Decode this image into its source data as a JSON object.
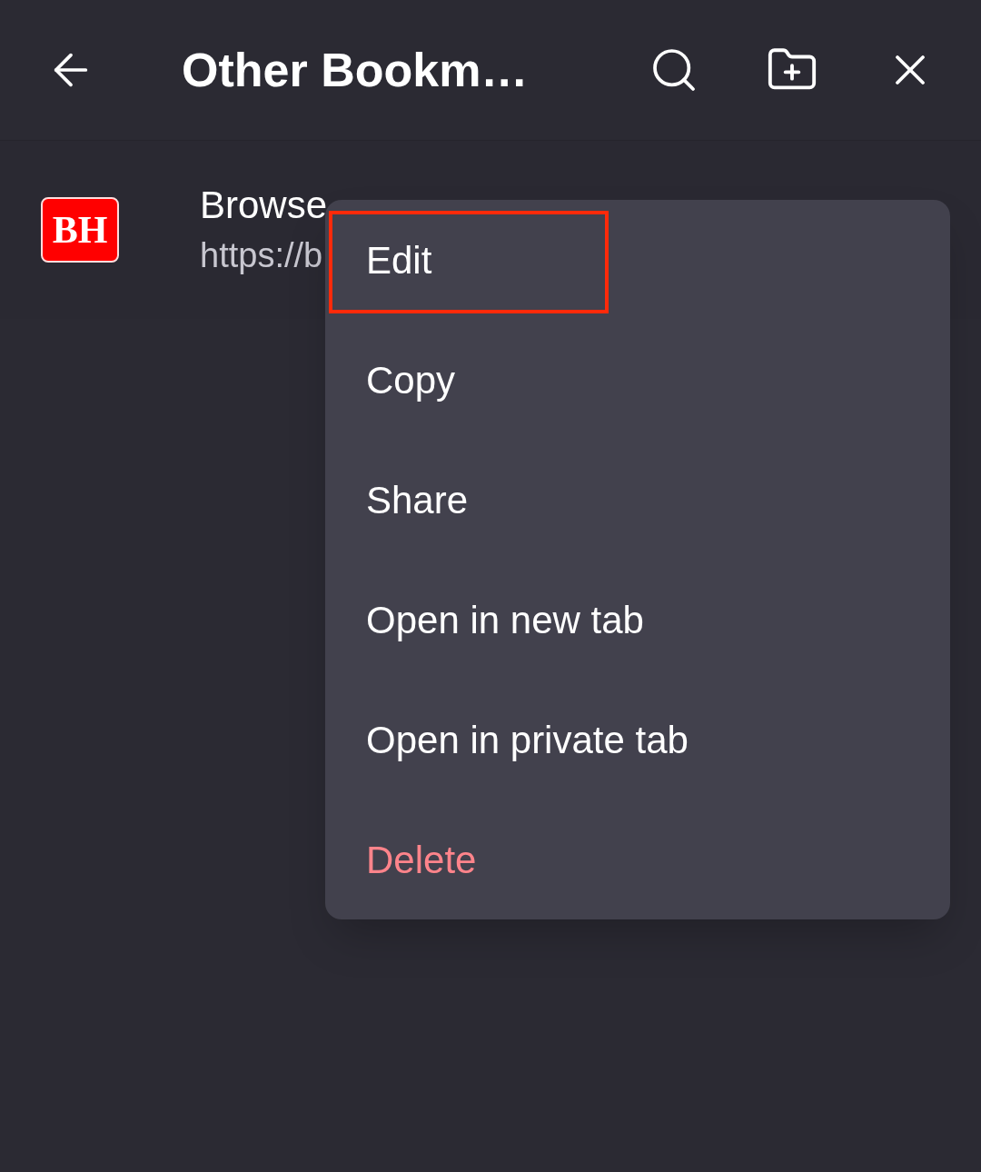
{
  "header": {
    "title": "Other Bookm…"
  },
  "bookmarks": [
    {
      "favicon_text": "BH",
      "title": "Browse",
      "url": "https://b"
    }
  ],
  "context_menu": {
    "items": [
      {
        "label": "Edit",
        "kind": "normal",
        "highlighted": true
      },
      {
        "label": "Copy",
        "kind": "normal",
        "highlighted": false
      },
      {
        "label": "Share",
        "kind": "normal",
        "highlighted": false
      },
      {
        "label": "Open in new tab",
        "kind": "normal",
        "highlighted": false
      },
      {
        "label": "Open in private tab",
        "kind": "normal",
        "highlighted": false
      },
      {
        "label": "Delete",
        "kind": "danger",
        "highlighted": false
      }
    ]
  }
}
